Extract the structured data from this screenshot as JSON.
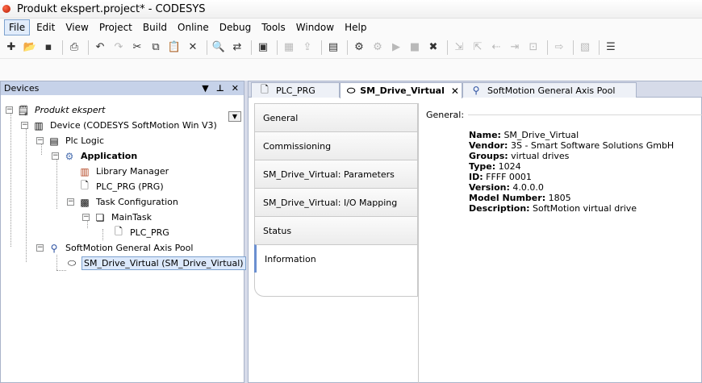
{
  "window": {
    "title": "Produkt ekspert.project* - CODESYS"
  },
  "menu": [
    {
      "label": "File"
    },
    {
      "label": "Edit"
    },
    {
      "label": "View"
    },
    {
      "label": "Project"
    },
    {
      "label": "Build"
    },
    {
      "label": "Online"
    },
    {
      "label": "Debug"
    },
    {
      "label": "Tools"
    },
    {
      "label": "Window"
    },
    {
      "label": "Help"
    }
  ],
  "devices": {
    "title": "Devices",
    "tree": [
      {
        "label": "Produkt ekspert"
      },
      {
        "label": "Device (CODESYS SoftMotion Win V3)"
      },
      {
        "label": "Plc Logic"
      },
      {
        "label": "Application"
      },
      {
        "label": "Library Manager"
      },
      {
        "label": "PLC_PRG (PRG)"
      },
      {
        "label": "Task Configuration"
      },
      {
        "label": "MainTask"
      },
      {
        "label": "PLC_PRG"
      },
      {
        "label": "SoftMotion General Axis Pool"
      },
      {
        "label": "SM_Drive_Virtual (SM_Drive_Virtual)"
      }
    ]
  },
  "tabs": [
    {
      "label": "PLC_PRG"
    },
    {
      "label": "SM_Drive_Virtual"
    },
    {
      "label": "SoftMotion General Axis Pool"
    }
  ],
  "vtabs": [
    {
      "label": "General"
    },
    {
      "label": "Commissioning"
    },
    {
      "label": "SM_Drive_Virtual: Parameters"
    },
    {
      "label": "SM_Drive_Virtual: I/O Mapping"
    },
    {
      "label": "Status"
    },
    {
      "label": "Information"
    }
  ],
  "info": {
    "section": "General:",
    "props": [
      {
        "key": "Name:",
        "value": "SM_Drive_Virtual"
      },
      {
        "key": "Vendor:",
        "value": "3S - Smart Software Solutions GmbH"
      },
      {
        "key": "Groups:",
        "value": "virtual drives"
      },
      {
        "key": "Type:",
        "value": "1024"
      },
      {
        "key": "ID:",
        "value": "FFFF 0001"
      },
      {
        "key": "Version:",
        "value": "4.0.0.0"
      },
      {
        "key": "Model Number:",
        "value": "1805"
      },
      {
        "key": "Description:",
        "value": "SoftMotion virtual drive"
      }
    ]
  }
}
